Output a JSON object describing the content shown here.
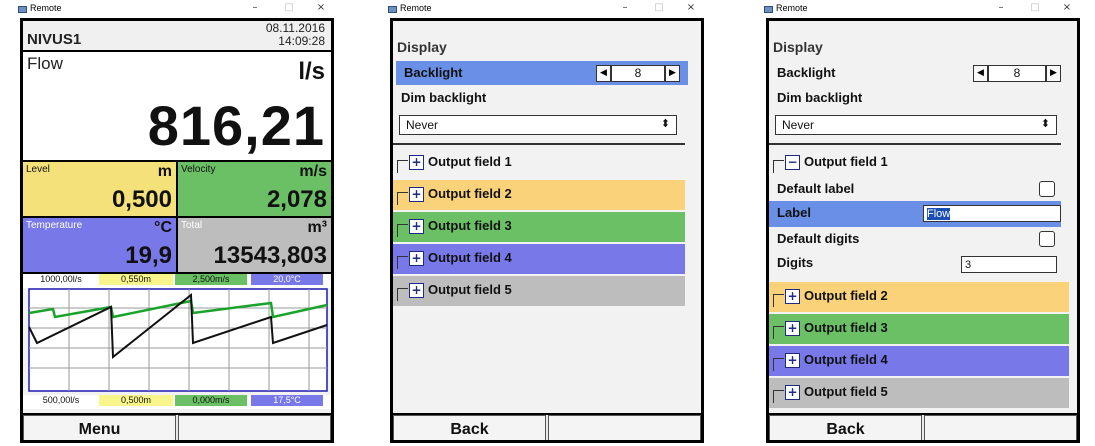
{
  "windows": [
    {
      "title": "Remote",
      "controls": {
        "minimize": "–",
        "maximize": "□",
        "close": "×"
      },
      "device_name": "NIVUS1",
      "date": "08.11.2016",
      "time": "14:09:28",
      "flow": {
        "label": "Flow",
        "unit": "l/s",
        "value": "816,21"
      },
      "tiles": [
        {
          "label": "Level",
          "unit": "m",
          "value": "0,500",
          "color": "#f5e17a"
        },
        {
          "label": "Velocity",
          "unit": "m/s",
          "value": "2,078",
          "color": "#6bbf65"
        },
        {
          "label": "Temperature",
          "unit": "°C",
          "value": "19,9",
          "color": "#7878e8"
        },
        {
          "label": "Total",
          "unit": "m³",
          "value": "13543,803",
          "color": "#bdbdbd"
        }
      ],
      "chart_top_labels": [
        "1000,00l/s",
        "0,550m",
        "2,500m/s",
        "20,0°C"
      ],
      "chart_bottom_labels": [
        "500,00l/s",
        "0,500m",
        "0,000m/s",
        "17,5°C"
      ],
      "buttons": [
        "Menu",
        ""
      ]
    },
    {
      "title": "Remote",
      "controls": {
        "minimize": "–",
        "maximize": "□",
        "close": "×"
      },
      "section": "Display",
      "backlight_label": "Backlight",
      "backlight_value": "8",
      "dim_label": "Dim backlight",
      "dim_value": "Never",
      "output_fields": [
        "Output field 1",
        "Output field 2",
        "Output field 3",
        "Output field 4",
        "Output field 5"
      ],
      "buttons": [
        "Back",
        ""
      ]
    },
    {
      "title": "Remote",
      "controls": {
        "minimize": "–",
        "maximize": "□",
        "close": "×"
      },
      "section": "Display",
      "backlight_label": "Backlight",
      "backlight_value": "8",
      "dim_label": "Dim backlight",
      "dim_value": "Never",
      "expanded_field": "Output field 1",
      "default_label": "Default label",
      "label_label": "Label",
      "label_value": "Flow",
      "default_digits": "Default digits",
      "digits_label": "Digits",
      "digits_value": "3",
      "output_fields": [
        "Output field 2",
        "Output field 3",
        "Output field 4",
        "Output field 5"
      ],
      "buttons": [
        "Back",
        ""
      ]
    }
  ],
  "colors": {
    "field2": "#f9d27a",
    "field3": "#6bbf65",
    "field4": "#7878e8",
    "field5": "#bdbdbd",
    "highlight": "#6a8fe6"
  }
}
